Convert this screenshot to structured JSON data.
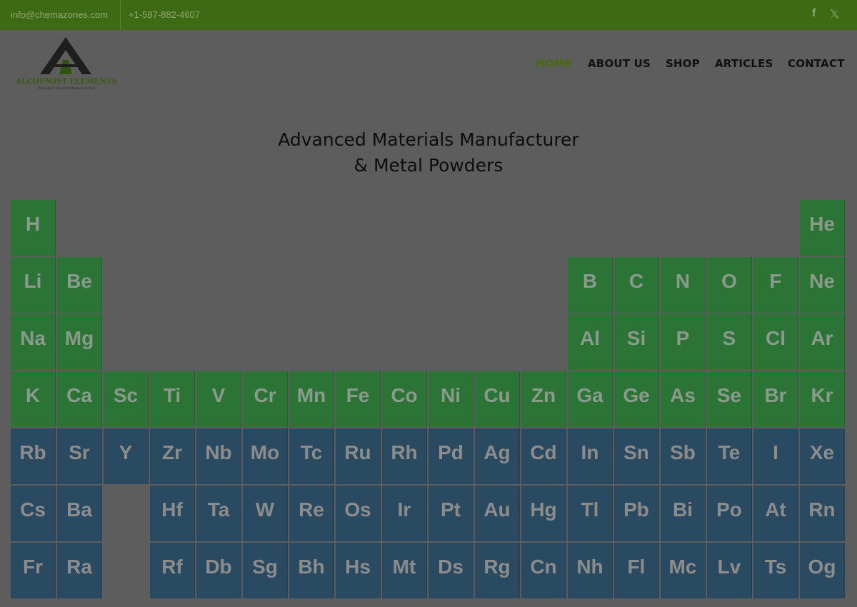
{
  "topbar": {
    "email": "info@chemazones.com",
    "phone": "+1-587-882-4607",
    "icons": [
      "facebook-icon",
      "x-icon"
    ]
  },
  "logo": {
    "title": "ALCHEMIST ELEMENTS",
    "tagline": "Precision Quality Manufacturer"
  },
  "nav": [
    {
      "label": "HOME",
      "active": true
    },
    {
      "label": "ABOUT US",
      "active": false
    },
    {
      "label": "SHOP",
      "active": false
    },
    {
      "label": "ARTICLES",
      "active": false
    },
    {
      "label": "CONTACT",
      "active": false
    }
  ],
  "headline": {
    "line1": "Advanced Materials Manufacturer",
    "line2": "& Metal Powders"
  },
  "colors": {
    "topbar": "#3f6a14",
    "accent": "#4a6a12",
    "cell_green": "#2c7436",
    "cell_blue": "#2a4a61"
  },
  "periodic_table": {
    "rows": [
      {
        "color": "green",
        "elements": [
          {
            "symbol": "H",
            "group": 1
          },
          {
            "symbol": "He",
            "group": 18
          }
        ]
      },
      {
        "color": "green",
        "elements": [
          {
            "symbol": "Li",
            "group": 1
          },
          {
            "symbol": "Be",
            "group": 2
          },
          {
            "symbol": "B",
            "group": 13
          },
          {
            "symbol": "C",
            "group": 14
          },
          {
            "symbol": "N",
            "group": 15
          },
          {
            "symbol": "O",
            "group": 16
          },
          {
            "symbol": "F",
            "group": 17
          },
          {
            "symbol": "Ne",
            "group": 18
          }
        ]
      },
      {
        "color": "green",
        "elements": [
          {
            "symbol": "Na",
            "group": 1
          },
          {
            "symbol": "Mg",
            "group": 2
          },
          {
            "symbol": "Al",
            "group": 13
          },
          {
            "symbol": "Si",
            "group": 14
          },
          {
            "symbol": "P",
            "group": 15
          },
          {
            "symbol": "S",
            "group": 16
          },
          {
            "symbol": "Cl",
            "group": 17
          },
          {
            "symbol": "Ar",
            "group": 18
          }
        ]
      },
      {
        "color": "green",
        "elements": [
          {
            "symbol": "K",
            "group": 1
          },
          {
            "symbol": "Ca",
            "group": 2
          },
          {
            "symbol": "Sc",
            "group": 3
          },
          {
            "symbol": "Ti",
            "group": 4
          },
          {
            "symbol": "V",
            "group": 5
          },
          {
            "symbol": "Cr",
            "group": 6
          },
          {
            "symbol": "Mn",
            "group": 7
          },
          {
            "symbol": "Fe",
            "group": 8
          },
          {
            "symbol": "Co",
            "group": 9
          },
          {
            "symbol": "Ni",
            "group": 10
          },
          {
            "symbol": "Cu",
            "group": 11
          },
          {
            "symbol": "Zn",
            "group": 12
          },
          {
            "symbol": "Ga",
            "group": 13
          },
          {
            "symbol": "Ge",
            "group": 14
          },
          {
            "symbol": "As",
            "group": 15
          },
          {
            "symbol": "Se",
            "group": 16
          },
          {
            "symbol": "Br",
            "group": 17
          },
          {
            "symbol": "Kr",
            "group": 18
          }
        ]
      },
      {
        "color": "blue",
        "elements": [
          {
            "symbol": "Rb",
            "group": 1
          },
          {
            "symbol": "Sr",
            "group": 2
          },
          {
            "symbol": "Y",
            "group": 3
          },
          {
            "symbol": "Zr",
            "group": 4
          },
          {
            "symbol": "Nb",
            "group": 5
          },
          {
            "symbol": "Mo",
            "group": 6
          },
          {
            "symbol": "Tc",
            "group": 7
          },
          {
            "symbol": "Ru",
            "group": 8
          },
          {
            "symbol": "Rh",
            "group": 9
          },
          {
            "symbol": "Pd",
            "group": 10
          },
          {
            "symbol": "Ag",
            "group": 11
          },
          {
            "symbol": "Cd",
            "group": 12
          },
          {
            "symbol": "In",
            "group": 13
          },
          {
            "symbol": "Sn",
            "group": 14
          },
          {
            "symbol": "Sb",
            "group": 15
          },
          {
            "symbol": "Te",
            "group": 16
          },
          {
            "symbol": "I",
            "group": 17
          },
          {
            "symbol": "Xe",
            "group": 18
          }
        ]
      },
      {
        "color": "blue",
        "elements": [
          {
            "symbol": "Cs",
            "group": 1
          },
          {
            "symbol": "Ba",
            "group": 2
          },
          {
            "symbol": "Hf",
            "group": 4
          },
          {
            "symbol": "Ta",
            "group": 5
          },
          {
            "symbol": "W",
            "group": 6
          },
          {
            "symbol": "Re",
            "group": 7
          },
          {
            "symbol": "Os",
            "group": 8
          },
          {
            "symbol": "Ir",
            "group": 9
          },
          {
            "symbol": "Pt",
            "group": 10
          },
          {
            "symbol": "Au",
            "group": 11
          },
          {
            "symbol": "Hg",
            "group": 12
          },
          {
            "symbol": "Tl",
            "group": 13
          },
          {
            "symbol": "Pb",
            "group": 14
          },
          {
            "symbol": "Bi",
            "group": 15
          },
          {
            "symbol": "Po",
            "group": 16
          },
          {
            "symbol": "At",
            "group": 17
          },
          {
            "symbol": "Rn",
            "group": 18
          }
        ]
      },
      {
        "color": "blue",
        "elements": [
          {
            "symbol": "Fr",
            "group": 1
          },
          {
            "symbol": "Ra",
            "group": 2
          },
          {
            "symbol": "Rf",
            "group": 4
          },
          {
            "symbol": "Db",
            "group": 5
          },
          {
            "symbol": "Sg",
            "group": 6
          },
          {
            "symbol": "Bh",
            "group": 7
          },
          {
            "symbol": "Hs",
            "group": 8
          },
          {
            "symbol": "Mt",
            "group": 9
          },
          {
            "symbol": "Ds",
            "group": 10
          },
          {
            "symbol": "Rg",
            "group": 11
          },
          {
            "symbol": "Cn",
            "group": 12
          },
          {
            "symbol": "Nh",
            "group": 13
          },
          {
            "symbol": "Fl",
            "group": 14
          },
          {
            "symbol": "Mc",
            "group": 15
          },
          {
            "symbol": "Lv",
            "group": 16
          },
          {
            "symbol": "Ts",
            "group": 17
          },
          {
            "symbol": "Og",
            "group": 18
          }
        ]
      }
    ]
  }
}
